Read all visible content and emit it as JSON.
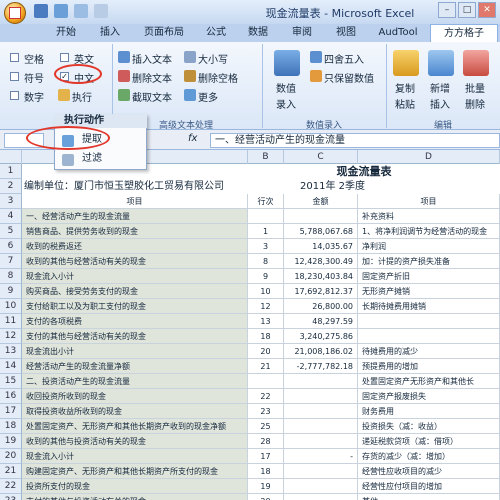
{
  "title": "现金流量表 - Microsoft Excel",
  "tabs": [
    "开始",
    "插入",
    "页面布局",
    "公式",
    "数据",
    "审阅",
    "视图",
    "AudTool",
    "方方格子"
  ],
  "ribbon": {
    "filter_group": {
      "checkboxes": [
        "空格",
        "英文",
        "符号",
        "中文",
        "数字"
      ],
      "execute": "执行"
    },
    "text_group": {
      "insert_text": "插入文本",
      "delete_text": "删除文本",
      "extract_text": "截取文本",
      "case": "大小写",
      "delete_space": "删除空格",
      "more": "更多",
      "label": "高级文本处理"
    },
    "number_group": {
      "numeric": "数值",
      "entry": "录入",
      "round": "四舍五入",
      "keep_number": "只保留数值",
      "label": "数值录入"
    },
    "edit_group": {
      "copy": "复制",
      "paste": "粘贴",
      "new": "新增",
      "insert": "插入",
      "batch": "批量",
      "delete": "删除",
      "label": "编辑"
    }
  },
  "dropdown": {
    "header": "执行动作",
    "items": [
      "提取",
      "过滤"
    ]
  },
  "formula_bar": {
    "fx": "fx",
    "value": "一、经营活动产生的现金流量"
  },
  "sheet": {
    "columns": [
      "A",
      "B",
      "C",
      "D"
    ],
    "report_title": "现金流量表",
    "company": "编制单位：厦门市恒玉塑胶化工贸易有限公司",
    "period": "2011年  2季度",
    "headers": [
      "项目",
      "行次",
      "金额",
      "项目"
    ],
    "rows": [
      {
        "n": "4",
        "a": "一、经营活动产生的现金流量",
        "b": "",
        "c": "",
        "d": "补充资料"
      },
      {
        "n": "5",
        "a": "销售商品、提供劳务收到的现金",
        "b": "1",
        "c": "5,788,067.68",
        "d": "1、将净利润调节为经营活动的现金"
      },
      {
        "n": "6",
        "a": "收到的税费返还",
        "b": "3",
        "c": "14,035.67",
        "d": "净利润"
      },
      {
        "n": "7",
        "a": "收到的其他与经营活动有关的现金",
        "b": "8",
        "c": "12,428,300.49",
        "d": "加：计提的资产损失准备"
      },
      {
        "n": "8",
        "a": "现金流入小计",
        "b": "9",
        "c": "18,230,403.84",
        "d": "固定资产折旧"
      },
      {
        "n": "9",
        "a": "购买商品、接受劳务支付的现金",
        "b": "10",
        "c": "17,692,812.37",
        "d": "无形资产摊销"
      },
      {
        "n": "10",
        "a": "支付给职工以及为职工支付的现金",
        "b": "12",
        "c": "26,800.00",
        "d": "长期待摊费用摊销"
      },
      {
        "n": "11",
        "a": "支付的各项税费",
        "b": "13",
        "c": "48,297.59",
        "d": ""
      },
      {
        "n": "12",
        "a": "支付的其他与经营活动有关的现金",
        "b": "18",
        "c": "3,240,275.86",
        "d": ""
      },
      {
        "n": "13",
        "a": "现金流出小计",
        "b": "20",
        "c": "21,008,186.02",
        "d": "待摊费用的减少"
      },
      {
        "n": "14",
        "a": "经营活动产生的现金流量净额",
        "b": "21",
        "c": "-2,777,782.18",
        "d": "预提费用的增加"
      },
      {
        "n": "15",
        "a": "二、投资活动产生的现金流量",
        "b": "",
        "c": "",
        "d": "处置固定资产无形资产和其他长"
      },
      {
        "n": "16",
        "a": "收回投资所收到的现金",
        "b": "22",
        "c": "",
        "d": "固定资产报废损失"
      },
      {
        "n": "17",
        "a": "取得投资收益所收到的现金",
        "b": "23",
        "c": "",
        "d": "财务费用"
      },
      {
        "n": "18",
        "a": "处置固定资产、无形资产和其他长期资产收到的现金净额",
        "b": "25",
        "c": "",
        "d": "投资损失（减：收益）"
      },
      {
        "n": "19",
        "a": "收到的其他与投资活动有关的现金",
        "b": "28",
        "c": "",
        "d": "递延税款贷项（减：借项）"
      },
      {
        "n": "20",
        "a": "现金流入小计",
        "b": "17",
        "c": "-",
        "d": "存货的减少（减：增加）"
      },
      {
        "n": "21",
        "a": "购建固定资产、无形资产和其他长期资产所支付的现金",
        "b": "18",
        "c": "",
        "d": "经营性应收项目的减少"
      },
      {
        "n": "22",
        "a": "投资所支付的现金",
        "b": "19",
        "c": "",
        "d": "经营性应付项目的增加"
      },
      {
        "n": "23",
        "a": "支付的其他与投资活动有关的现金",
        "b": "20",
        "c": "",
        "d": "其他"
      },
      {
        "n": "24",
        "a": "现金流出小计",
        "b": "21",
        "c": "-",
        "d": "经营活动产生的现金流量净额"
      }
    ]
  }
}
